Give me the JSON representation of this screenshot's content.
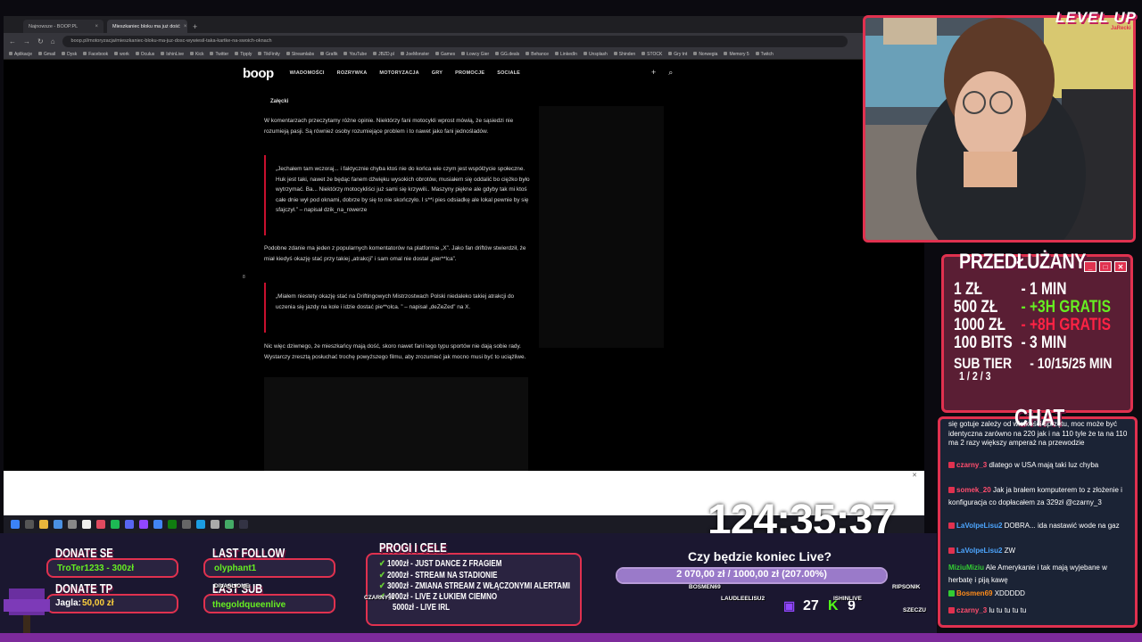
{
  "browser": {
    "tabs": [
      {
        "label": "Najnowsze - BOOP.PL"
      },
      {
        "label": "Mieszkaniec bloku ma już dość"
      }
    ],
    "url": "boop.pl/motoryzacja/mieszkaniec-bloku-ma-juz-dosc-wywiesil-taka-kartke-na-swoich-oknach",
    "bookmarks": [
      "Aplikacje",
      "Gmail",
      "Dysk",
      "Facebook",
      "work",
      "Oculus",
      "IshinLive",
      "Kick",
      "Twitter",
      "Tipply",
      "TikFinity",
      "Streamlabs",
      "Grafik",
      "YouTube",
      "JBZD.pl",
      "JoeMonster",
      "Games",
      "Łowcy Gier",
      "GG.deals",
      "Behance",
      "LinkedIn",
      "Unsplash",
      "Shinden",
      "STOCK",
      "Gry tnt",
      "Norwegia",
      "Memory 5",
      "Twitch"
    ]
  },
  "site": {
    "logo": "boop",
    "nav": [
      "WIADOMOŚCI",
      "ROZRYWKA",
      "MOTORYZACJA",
      "GRY",
      "PROMOCJE",
      "SOCIALE"
    ],
    "author": "Załęcki",
    "p1": "W komentarzach przeczytamy różne opinie. Niektórzy fani motocykli wprost mówią, że sąsiedzi nie rozumieją pasji. Są również osoby rozumiejące problem i to nawet jako fani jednośladów.",
    "q1": "„Jechałem tam wczoraj... i faktycznie chyba ktoś nie do końca wie czym jest współżycie społeczne. Huk jest taki, nawet że będąc fanem dźwięku wysokich obrotów, musiałem się oddalić bo ciężko było wytrzymać. Ba... Niektórzy motocykliści już sami się krzywili.. Maszyny piękne ale gdyby tak mi ktoś całe dnie wył pod oknami, dobrze by się to nie skończyło. I s**i pies odsiadkę ale lokal pewnie by się sfajczył.” – napisał dzik_na_rowerze",
    "p2": "Podobne zdanie ma jeden z popularnych komentatorów na platformie „X”. Jako fan driftów stwierdził, że miał kiedyś okazję stać przy takiej „atrakcji” i sam omal nie dostał „pier**lca”.",
    "q2": "„Miałem niestety okazję stać na Driftingowych Mistrzostwach Polski niedaleko takiej atrakcji do uczenia się jazdy na kole i idzie dostać pie**olca. ” – napisał „deZeZed” na X.",
    "p3": "Nic więc dziwnego, że mieszkańcy mają dość, skoro nawet fani tego typu sportów nie dają sobie rady. Wystarczy zresztą posłuchać trochę powyższego filmu, aby zrozumieć jak mocno musi być to uciążliwe.",
    "tiny": "8"
  },
  "overlay": {
    "brand": "LEVEL UP",
    "brand_sub": "JaRecki",
    "ext_title": "PRZEDŁUŻANY",
    "ext_rows": [
      {
        "amount": "1 ZŁ",
        "time": "- 1 MIN"
      },
      {
        "amount": "500 ZŁ",
        "time": "- +3H GRATIS"
      },
      {
        "amount": "1000 ZŁ",
        "time": "- +8H GRATIS"
      },
      {
        "amount": "100 BITS",
        "time": "- 3 MIN"
      },
      {
        "amount": "SUB TIER",
        "time": "- 10/15/25 MIN"
      }
    ],
    "sub_tiers": "1 / 2 / 3",
    "chat_title": "CHAT",
    "timer": "124:35:37",
    "donate_se_label": "DONATE SE",
    "donate_se_value": "TroTer1233 - 300zł",
    "donate_tp_label": "DONATE TP",
    "donate_tp_name": "Jagla:",
    "donate_tp_amount": "50,00 zł",
    "last_follow_label": "LAST FOLLOW",
    "last_follow_value": "olyphant1",
    "last_sub_label": "LAST SUB",
    "last_sub_value": "thegoldqueenlive",
    "goals_title": "PROGI I CELE",
    "goals": [
      "1000zł - JUST DANCE Z FRAGIEM",
      "2000zł - STREAM NA STADIONIE",
      "3000zł - ZMIANA STREAM Z WŁĄCZONYMI ALERTAMI",
      "4000zł - LIVE Z ŁUKIEM CIEMNO",
      "5000zł - LIVE IRL"
    ],
    "live_question": "Czy będzie koniec Live?",
    "live_progress_text": "2 070,00 zł / 1000,00 zł (207.00%)",
    "live_progress_fraction": 1.0,
    "viewers_twitch": "27",
    "viewers_kick": "9",
    "names_overlay": [
      "DIVASLIONE",
      "BOSMEN69",
      "LAUDLEELISU2",
      "ISHINLIVE",
      "RIPSONIK",
      "SZECZU",
      "CZARNY_3"
    ]
  },
  "chat": [
    {
      "user": "",
      "text": "się gotuje zależy od wielkości sprzętu, moc może być identyczna zarówno na 220 jak i na 110 tyle że ta na 110 ma 2 razy większy amperaż na przewodzie"
    },
    {
      "user": "czarny_3",
      "text": "dlatego w USA mają taki luz chyba"
    },
    {
      "user": "somek_20",
      "text": "Jak ja brałem komputerem to z złożenie i konfiguracja co dopłacałem za 329zł @czarny_3"
    },
    {
      "user": "LaVolpeLisu2",
      "text": "DOBRA... ida nastawić wode na gaz"
    },
    {
      "user": "LaVolpeLisu2",
      "text": "ZW"
    },
    {
      "user": "MiziuMiziu",
      "text": "Ale Amerykanie i tak mają wyjebane w herbatę i piją kawę"
    },
    {
      "user": "Bosmen69",
      "text": "XDDDDD"
    },
    {
      "user": "czarny_3",
      "text": "lu tu tu tu tu"
    }
  ],
  "colors": {
    "accent": "#e0314f",
    "green": "#33cc33",
    "gratis_green": "#66ee22",
    "gratis_red": "#ff2244",
    "minutes_green": "#66ee22"
  }
}
